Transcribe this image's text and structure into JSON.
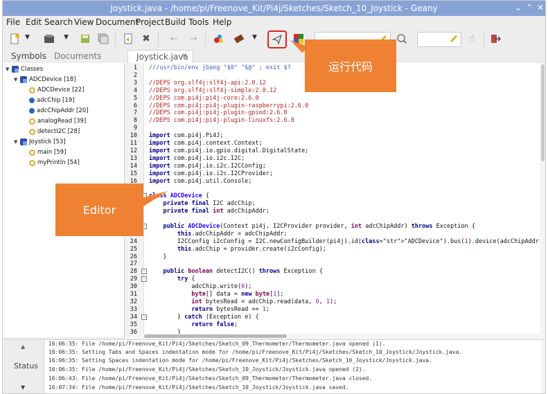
{
  "window": {
    "title": "Joystick.java - /home/pi/Freenove_Kit/Pi4j/Sketches/Sketch_10_Joystick - Geany",
    "controls": [
      "⌄",
      "⌃",
      "✕"
    ]
  },
  "menu": [
    "File",
    "Edit",
    "Search",
    "View",
    "Document",
    "Project",
    "Build",
    "Tools",
    "Help"
  ],
  "sidebar": {
    "tabs": [
      "Symbols",
      "Documents"
    ],
    "tree": [
      {
        "label": "Classes",
        "icon": "class-icon",
        "expanded": true
      },
      {
        "label": "ADCDevice [18]",
        "icon": "class-icon",
        "expanded": true
      },
      {
        "label": "ADCDevice [22]",
        "icon": "method-icon"
      },
      {
        "label": "adcChip [19]",
        "icon": "variable-icon"
      },
      {
        "label": "adcChipAddr [20]",
        "icon": "variable-icon"
      },
      {
        "label": "analogRead [39]",
        "icon": "method-icon"
      },
      {
        "label": "detectI2C [28]",
        "icon": "method-icon"
      },
      {
        "label": "Joystick [53]",
        "icon": "class-icon",
        "expanded": true
      },
      {
        "label": "main [59]",
        "icon": "method-icon"
      },
      {
        "label": "myPrintln [54]",
        "icon": "method-icon"
      }
    ]
  },
  "editor": {
    "tab_label": "Joystick.java",
    "tab_close": "×",
    "line_numbers": [
      "1",
      "2",
      "3",
      "4",
      "5",
      "6",
      "7",
      "8",
      "9",
      "10",
      "11",
      "12",
      "13",
      "14",
      "15",
      "16",
      "17",
      "18",
      "19",
      "20",
      "21",
      "22",
      "23",
      "24",
      "25",
      "26",
      "27",
      "28",
      "29",
      "30",
      "31",
      "32",
      "33",
      "34",
      "35",
      "36"
    ],
    "lines": [
      "///usr/bin/env jbang \"$0\" \"$@\" ; exit $?",
      "",
      "//DEPS org.slf4j:slf4j-api:2.0.12",
      "//DEPS org.slf4j:slf4j-simple:2.0.12",
      "//DEPS com.pi4j:pi4j-core:2.6.0",
      "//DEPS com.pi4j:pi4j-plugin-raspberrypi:2.6.0",
      "//DEPS com.pi4j:pi4j-plugin-gpiod:2.6.0",
      "//DEPS com.pi4j:pi4j-plugin-linuxfs:2.6.0",
      "",
      "import com.pi4j.Pi4J;",
      "import com.pi4j.context.Context;",
      "import com.pi4j.io.gpio.digital.DigitalState;",
      "import com.pi4j.io.i2c.I2C;",
      "import com.pi4j.io.i2c.I2CConfig;",
      "import com.pi4j.io.i2c.I2CProvider;",
      "import com.pi4j.util.Console;",
      "",
      "class ADCDevice {",
      "    private final I2C adcChip;",
      "    private final int adcChipAddr;",
      "",
      "    public ADCDevice(Context pi4j, I2CProvider provider, int adcChipAddr) throws Exception {",
      "        this.adcChipAddr = adcChipAddr;",
      "        I2CConfig i2cConfig = I2C.newConfigBuilder(pi4j).id(\"ADCDevice\").bus(1).device(adcChipAddr).build();",
      "        this.adcChip = provider.create(i2cConfig);",
      "    }",
      "",
      "    public boolean detectI2C() throws Exception {",
      "        try {",
      "            adcChip.write(0);",
      "            byte[] data = new byte[1];",
      "            int bytesRead = adcChip.read(data, 0, 1);",
      "            return bytesRead == 1;",
      "        } catch (Exception e) {",
      "            return false;",
      "        }"
    ]
  },
  "messages": {
    "tab_label": "Status",
    "lines": [
      "16:06:35: File /home/pi/Freenove_Kit/Pi4j/Sketches/Sketch_09_Thermometer/Thermometer.java opened (1).",
      "16:06:35: Setting Tabs and Spaces indentation mode for /home/pi/Freenove_Kit/Pi4j/Sketches/Sketch_10_Joystick/Joystick.java.",
      "16:06:35: Setting Spaces indentation mode for /home/pi/Freenove_Kit/Pi4j/Sketches/Sketch_10_Joystick/Joystick.java.",
      "16:06:35: File /home/pi/Freenove_Kit/Pi4j/Sketches/Sketch_10_Joystick/Joystick.java opened (2).",
      "16:06:43: File /home/pi/Freenove_Kit/Pi4j/Sketches/Sketch_09_Thermometer/Thermometer.java closed.",
      "16:07:34: File /home/pi/Freenove_Kit/Pi4j/Sketches/Sketch_10_Joystick/Joystick.java saved."
    ]
  },
  "annotations": {
    "run_label": "运行代码",
    "editor_label": "Editor",
    "callout_color": "#ef8133",
    "highlight_color": "#e02020"
  }
}
